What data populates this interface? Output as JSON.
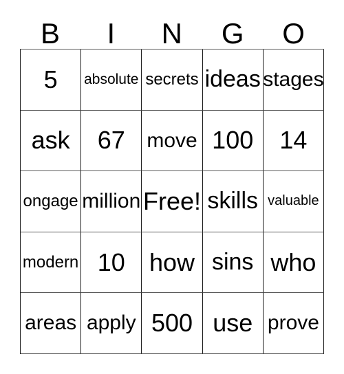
{
  "card": {
    "headers": [
      "B",
      "I",
      "N",
      "G",
      "O"
    ],
    "rows": [
      [
        {
          "text": "5",
          "size": "fs-xl"
        },
        {
          "text": "absolute",
          "size": "fs-xs"
        },
        {
          "text": "secrets",
          "size": "fs-sm"
        },
        {
          "text": "ideas",
          "size": "fs-lg"
        },
        {
          "text": "stages",
          "size": "fs-md"
        }
      ],
      [
        {
          "text": "ask",
          "size": "fs-xl"
        },
        {
          "text": "67",
          "size": "fs-xl"
        },
        {
          "text": "move",
          "size": "fs-md"
        },
        {
          "text": "100",
          "size": "fs-xl"
        },
        {
          "text": "14",
          "size": "fs-xl"
        }
      ],
      [
        {
          "text": "ongage",
          "size": "fs-sm"
        },
        {
          "text": "million",
          "size": "fs-md"
        },
        {
          "text": "Free!",
          "size": "fs-xl"
        },
        {
          "text": "skills",
          "size": "fs-lg"
        },
        {
          "text": "valuable",
          "size": "fs-xxs"
        }
      ],
      [
        {
          "text": "modern",
          "size": "fs-sm"
        },
        {
          "text": "10",
          "size": "fs-xl"
        },
        {
          "text": "how",
          "size": "fs-xl"
        },
        {
          "text": "sins",
          "size": "fs-lg"
        },
        {
          "text": "who",
          "size": "fs-xl"
        }
      ],
      [
        {
          "text": "areas",
          "size": "fs-md"
        },
        {
          "text": "apply",
          "size": "fs-md"
        },
        {
          "text": "500",
          "size": "fs-xl"
        },
        {
          "text": "use",
          "size": "fs-xl"
        },
        {
          "text": "prove",
          "size": "fs-md"
        }
      ]
    ],
    "free_space": {
      "row": 2,
      "col": 2,
      "label": "Free!"
    },
    "colors": {
      "background": "#ffffff",
      "text": "#000000",
      "grid_line_vertical": "#1c1c1c",
      "grid_line_horizontal": "#5a5a5a"
    }
  }
}
